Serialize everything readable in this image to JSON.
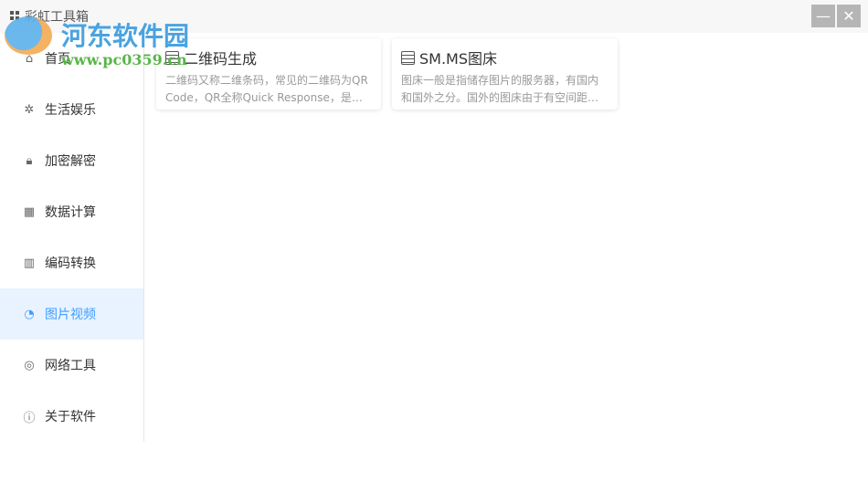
{
  "window": {
    "title": "彩虹工具箱",
    "minimize": "—",
    "close": "✕"
  },
  "sidebar": {
    "items": [
      {
        "label": "首页",
        "icon": "home-icon",
        "glyph": "⌂"
      },
      {
        "label": "生活娱乐",
        "icon": "sparkle-icon",
        "glyph": "✲"
      },
      {
        "label": "加密解密",
        "icon": "lock-icon",
        "glyph": "🔒︎"
      },
      {
        "label": "数据计算",
        "icon": "calculator-icon",
        "glyph": "▦"
      },
      {
        "label": "编码转换",
        "icon": "barcode-icon",
        "glyph": "▥"
      },
      {
        "label": "图片视频",
        "icon": "image-icon",
        "glyph": "◔",
        "active": true
      },
      {
        "label": "网络工具",
        "icon": "network-icon",
        "glyph": "◎"
      },
      {
        "label": "关于软件",
        "icon": "info-icon",
        "glyph": "ⓘ"
      }
    ]
  },
  "cards": [
    {
      "title": "二维码生成",
      "desc": "二维码又称二维条码，常见的二维码为QR Code，QR全称Quick Response，是一种在移动设备上超流行的编码方式"
    },
    {
      "title": "SM.MS图床",
      "desc": "图床一般是指储存图片的服务器，有国内和国外之分。国外的图床由于有空间距离等因素"
    }
  ],
  "watermark": {
    "name": "河东软件园",
    "url": "www.pc0359.cn"
  },
  "colors": {
    "accent": "#409eff",
    "active_bg": "#e8f3ff"
  }
}
